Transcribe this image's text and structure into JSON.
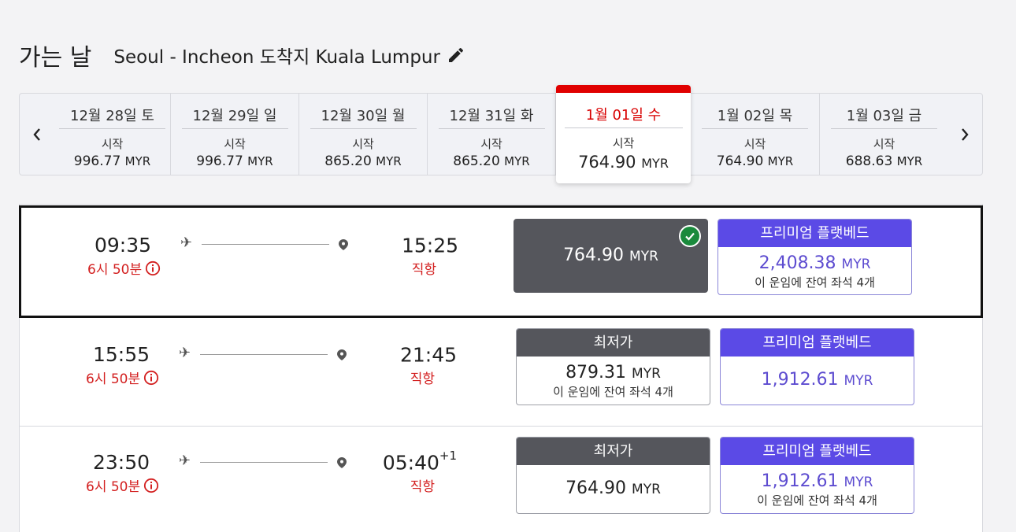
{
  "header": {
    "title": "가는 날",
    "route": "Seoul - Incheon 도착지 Kuala Lumpur"
  },
  "dates": [
    {
      "label": "12월 28일 토",
      "from": "시작",
      "price": "996.77",
      "currency": "MYR"
    },
    {
      "label": "12월 29일 일",
      "from": "시작",
      "price": "996.77",
      "currency": "MYR"
    },
    {
      "label": "12월 30일 월",
      "from": "시작",
      "price": "865.20",
      "currency": "MYR"
    },
    {
      "label": "12월 31일 화",
      "from": "시작",
      "price": "865.20",
      "currency": "MYR"
    },
    {
      "label": "1월 01일 수",
      "from": "시작",
      "price": "764.90",
      "currency": "MYR",
      "selected": true
    },
    {
      "label": "1월 02일 목",
      "from": "시작",
      "price": "764.90",
      "currency": "MYR"
    },
    {
      "label": "1월 03일 금",
      "from": "시작",
      "price": "688.63",
      "currency": "MYR"
    }
  ],
  "flights": [
    {
      "departure": "09:35",
      "duration": "6시 50분",
      "arrival": "15:25",
      "arrival_day_offset": "",
      "stops": "직항",
      "economy": {
        "label": "",
        "price": "764.90",
        "currency": "MYR",
        "seats": "",
        "selected": true
      },
      "premium": {
        "label": "프리미엄 플랫베드",
        "price": "2,408.38",
        "currency": "MYR",
        "seats": "이 운임에 잔여 좌석 4개"
      }
    },
    {
      "departure": "15:55",
      "duration": "6시 50분",
      "arrival": "21:45",
      "arrival_day_offset": "",
      "stops": "직항",
      "economy": {
        "label": "최저가",
        "price": "879.31",
        "currency": "MYR",
        "seats": "이 운임에 잔여 좌석 4개"
      },
      "premium": {
        "label": "프리미엄 플랫베드",
        "price": "1,912.61",
        "currency": "MYR",
        "seats": ""
      }
    },
    {
      "departure": "23:50",
      "duration": "6시 50분",
      "arrival": "05:40",
      "arrival_day_offset": "+1",
      "stops": "직항",
      "economy": {
        "label": "최저가",
        "price": "764.90",
        "currency": "MYR",
        "seats": ""
      },
      "premium": {
        "label": "프리미엄 플랫베드",
        "price": "1,912.61",
        "currency": "MYR",
        "seats": "이 운임에 잔여 좌석 4개"
      }
    }
  ],
  "colors": {
    "accent_red": "#e00000",
    "premium_purple": "#5b4ae6",
    "fare_gray": "#55565c",
    "check_green": "#1a8a3c"
  }
}
